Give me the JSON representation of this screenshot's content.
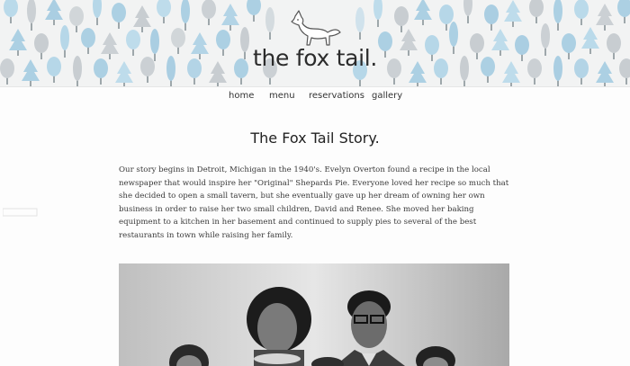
{
  "header": {
    "site_title": "the fox tail.",
    "logo": "fox-icon"
  },
  "nav": {
    "items": [
      "home",
      "menu",
      "reservations",
      "gallery"
    ]
  },
  "main": {
    "title": "The Fox Tail Story.",
    "story": "Our story begins in Detroit, Michigan in the 1940's. Evelyn Overton found a recipe in the local newspaper that would inspire her \"Original\" Shepards Pie. Everyone loved her recipe so much that she decided to open a small tavern, but she eventually gave up her dream of owning her own business in order to raise her two small children, David and Renee. She moved her baking equipment to a kitchen in her basement and continued to supply pies to several of the best restaurants in town while raising her family."
  },
  "colors": {
    "pattern_blue": "#a9cfe3",
    "pattern_gray": "#c8ced2",
    "background": "#fdfdfd",
    "text": "#3a3a3a"
  }
}
